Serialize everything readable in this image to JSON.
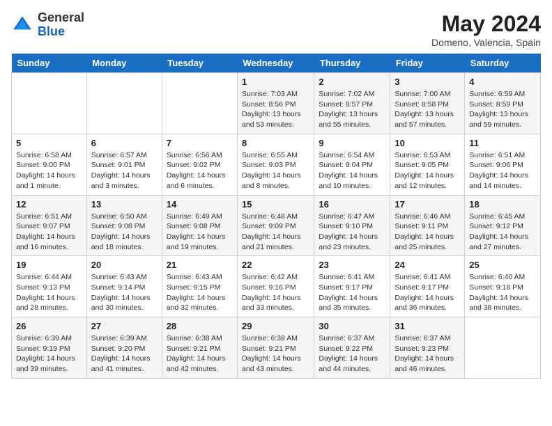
{
  "header": {
    "logo_general": "General",
    "logo_blue": "Blue",
    "month_year": "May 2024",
    "location": "Domeno, Valencia, Spain"
  },
  "weekdays": [
    "Sunday",
    "Monday",
    "Tuesday",
    "Wednesday",
    "Thursday",
    "Friday",
    "Saturday"
  ],
  "weeks": [
    [
      {
        "day": "",
        "info": ""
      },
      {
        "day": "",
        "info": ""
      },
      {
        "day": "",
        "info": ""
      },
      {
        "day": "1",
        "info": "Sunrise: 7:03 AM\nSunset: 8:56 PM\nDaylight: 13 hours\nand 53 minutes."
      },
      {
        "day": "2",
        "info": "Sunrise: 7:02 AM\nSunset: 8:57 PM\nDaylight: 13 hours\nand 55 minutes."
      },
      {
        "day": "3",
        "info": "Sunrise: 7:00 AM\nSunset: 8:58 PM\nDaylight: 13 hours\nand 57 minutes."
      },
      {
        "day": "4",
        "info": "Sunrise: 6:59 AM\nSunset: 8:59 PM\nDaylight: 13 hours\nand 59 minutes."
      }
    ],
    [
      {
        "day": "5",
        "info": "Sunrise: 6:58 AM\nSunset: 9:00 PM\nDaylight: 14 hours\nand 1 minute."
      },
      {
        "day": "6",
        "info": "Sunrise: 6:57 AM\nSunset: 9:01 PM\nDaylight: 14 hours\nand 3 minutes."
      },
      {
        "day": "7",
        "info": "Sunrise: 6:56 AM\nSunset: 9:02 PM\nDaylight: 14 hours\nand 6 minutes."
      },
      {
        "day": "8",
        "info": "Sunrise: 6:55 AM\nSunset: 9:03 PM\nDaylight: 14 hours\nand 8 minutes."
      },
      {
        "day": "9",
        "info": "Sunrise: 6:54 AM\nSunset: 9:04 PM\nDaylight: 14 hours\nand 10 minutes."
      },
      {
        "day": "10",
        "info": "Sunrise: 6:53 AM\nSunset: 9:05 PM\nDaylight: 14 hours\nand 12 minutes."
      },
      {
        "day": "11",
        "info": "Sunrise: 6:51 AM\nSunset: 9:06 PM\nDaylight: 14 hours\nand 14 minutes."
      }
    ],
    [
      {
        "day": "12",
        "info": "Sunrise: 6:51 AM\nSunset: 9:07 PM\nDaylight: 14 hours\nand 16 minutes."
      },
      {
        "day": "13",
        "info": "Sunrise: 6:50 AM\nSunset: 9:08 PM\nDaylight: 14 hours\nand 18 minutes."
      },
      {
        "day": "14",
        "info": "Sunrise: 6:49 AM\nSunset: 9:08 PM\nDaylight: 14 hours\nand 19 minutes."
      },
      {
        "day": "15",
        "info": "Sunrise: 6:48 AM\nSunset: 9:09 PM\nDaylight: 14 hours\nand 21 minutes."
      },
      {
        "day": "16",
        "info": "Sunrise: 6:47 AM\nSunset: 9:10 PM\nDaylight: 14 hours\nand 23 minutes."
      },
      {
        "day": "17",
        "info": "Sunrise: 6:46 AM\nSunset: 9:11 PM\nDaylight: 14 hours\nand 25 minutes."
      },
      {
        "day": "18",
        "info": "Sunrise: 6:45 AM\nSunset: 9:12 PM\nDaylight: 14 hours\nand 27 minutes."
      }
    ],
    [
      {
        "day": "19",
        "info": "Sunrise: 6:44 AM\nSunset: 9:13 PM\nDaylight: 14 hours\nand 28 minutes."
      },
      {
        "day": "20",
        "info": "Sunrise: 6:43 AM\nSunset: 9:14 PM\nDaylight: 14 hours\nand 30 minutes."
      },
      {
        "day": "21",
        "info": "Sunrise: 6:43 AM\nSunset: 9:15 PM\nDaylight: 14 hours\nand 32 minutes."
      },
      {
        "day": "22",
        "info": "Sunrise: 6:42 AM\nSunset: 9:16 PM\nDaylight: 14 hours\nand 33 minutes."
      },
      {
        "day": "23",
        "info": "Sunrise: 6:41 AM\nSunset: 9:17 PM\nDaylight: 14 hours\nand 35 minutes."
      },
      {
        "day": "24",
        "info": "Sunrise: 6:41 AM\nSunset: 9:17 PM\nDaylight: 14 hours\nand 36 minutes."
      },
      {
        "day": "25",
        "info": "Sunrise: 6:40 AM\nSunset: 9:18 PM\nDaylight: 14 hours\nand 38 minutes."
      }
    ],
    [
      {
        "day": "26",
        "info": "Sunrise: 6:39 AM\nSunset: 9:19 PM\nDaylight: 14 hours\nand 39 minutes."
      },
      {
        "day": "27",
        "info": "Sunrise: 6:39 AM\nSunset: 9:20 PM\nDaylight: 14 hours\nand 41 minutes."
      },
      {
        "day": "28",
        "info": "Sunrise: 6:38 AM\nSunset: 9:21 PM\nDaylight: 14 hours\nand 42 minutes."
      },
      {
        "day": "29",
        "info": "Sunrise: 6:38 AM\nSunset: 9:21 PM\nDaylight: 14 hours\nand 43 minutes."
      },
      {
        "day": "30",
        "info": "Sunrise: 6:37 AM\nSunset: 9:22 PM\nDaylight: 14 hours\nand 44 minutes."
      },
      {
        "day": "31",
        "info": "Sunrise: 6:37 AM\nSunset: 9:23 PM\nDaylight: 14 hours\nand 46 minutes."
      },
      {
        "day": "",
        "info": ""
      }
    ]
  ]
}
